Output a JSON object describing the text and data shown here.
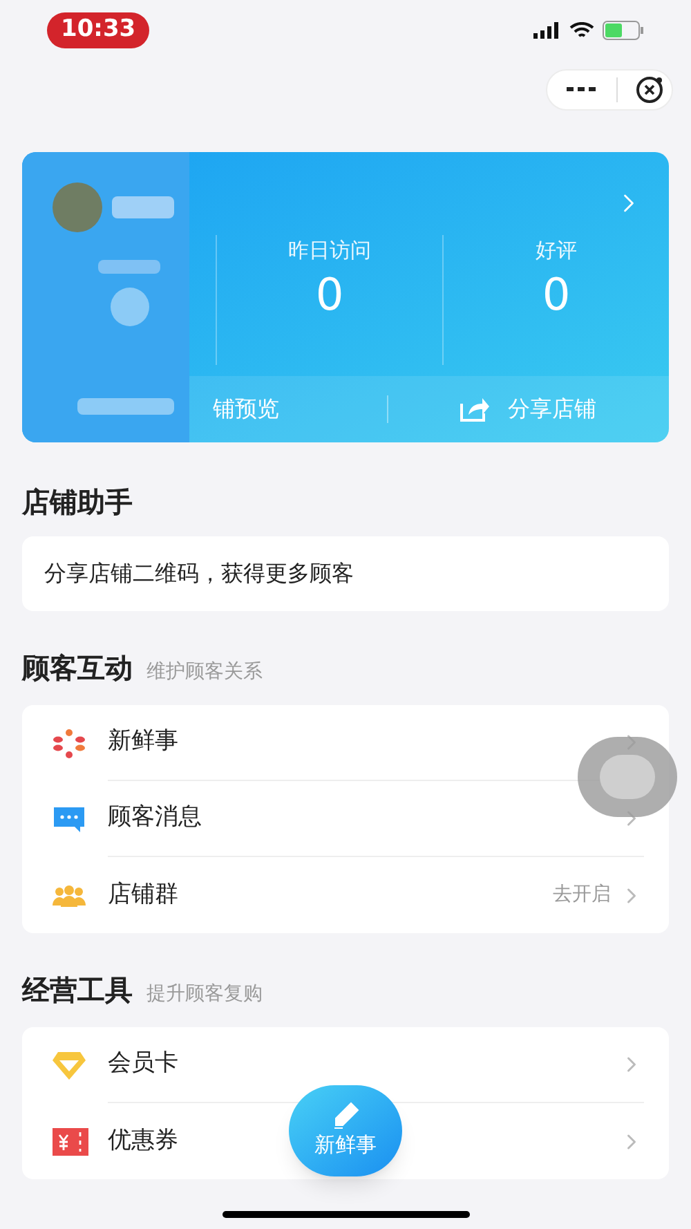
{
  "status_bar": {
    "time": "10:33"
  },
  "shop_card": {
    "stats": [
      {
        "label": "昨日访问",
        "value": "0"
      },
      {
        "label": "好评",
        "value": "0"
      }
    ],
    "actions": [
      {
        "kind": "preview",
        "label": "铺预览"
      },
      {
        "kind": "share",
        "label": "分享店铺"
      }
    ]
  },
  "assistant": {
    "title": "店铺助手",
    "tip": "分享店铺二维码，获得更多顾客"
  },
  "sections": [
    {
      "title": "顾客互动",
      "subtitle": "维护顾客关系",
      "items": [
        {
          "kind": "flower",
          "label": "新鲜事"
        },
        {
          "kind": "chat",
          "label": "顾客消息"
        },
        {
          "kind": "group",
          "label": "店铺群",
          "hint": "去开启"
        }
      ]
    },
    {
      "title": "经营工具",
      "subtitle": "提升顾客复购",
      "items": [
        {
          "kind": "diamond",
          "label": "会员卡"
        },
        {
          "kind": "coupon",
          "label": "优惠券"
        }
      ]
    }
  ],
  "fab": {
    "label": "新鲜事"
  }
}
